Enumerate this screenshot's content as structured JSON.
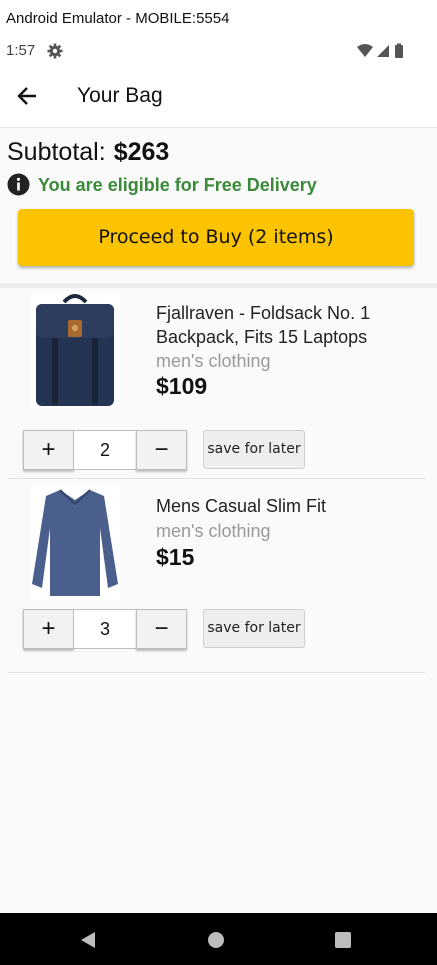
{
  "window": {
    "title": "Android Emulator - MOBILE:5554"
  },
  "status_bar": {
    "time": "1:57",
    "icons": [
      "gear-icon",
      "wifi-icon",
      "signal-icon",
      "battery-icon"
    ]
  },
  "app_bar": {
    "title": "Your Bag",
    "back_icon": "arrow-left-icon"
  },
  "summary": {
    "subtotal_label": "Subtotal:",
    "subtotal_value": "$263",
    "delivery_message": "You are eligible for Free Delivery",
    "delivery_color": "#3a8a3a",
    "buy_button": "Proceed to Buy (2 items)",
    "buy_button_color": "#fbc300"
  },
  "items": [
    {
      "name": "Fjallraven - Foldsack No. 1 Backpack, Fits 15 Laptops",
      "category": "men's clothing",
      "price": "$109",
      "quantity": "2",
      "plus_label": "+",
      "minus_label": "−",
      "save_label": "save for later",
      "image_icon": "backpack-image"
    },
    {
      "name": "Mens Casual Slim Fit",
      "category": "men's clothing",
      "price": "$15",
      "quantity": "3",
      "plus_label": "+",
      "minus_label": "−",
      "save_label": "save for later",
      "image_icon": "tshirt-image"
    }
  ],
  "nav_bar": {
    "icons": [
      "back-triangle-icon",
      "home-circle-icon",
      "recents-square-icon"
    ]
  }
}
